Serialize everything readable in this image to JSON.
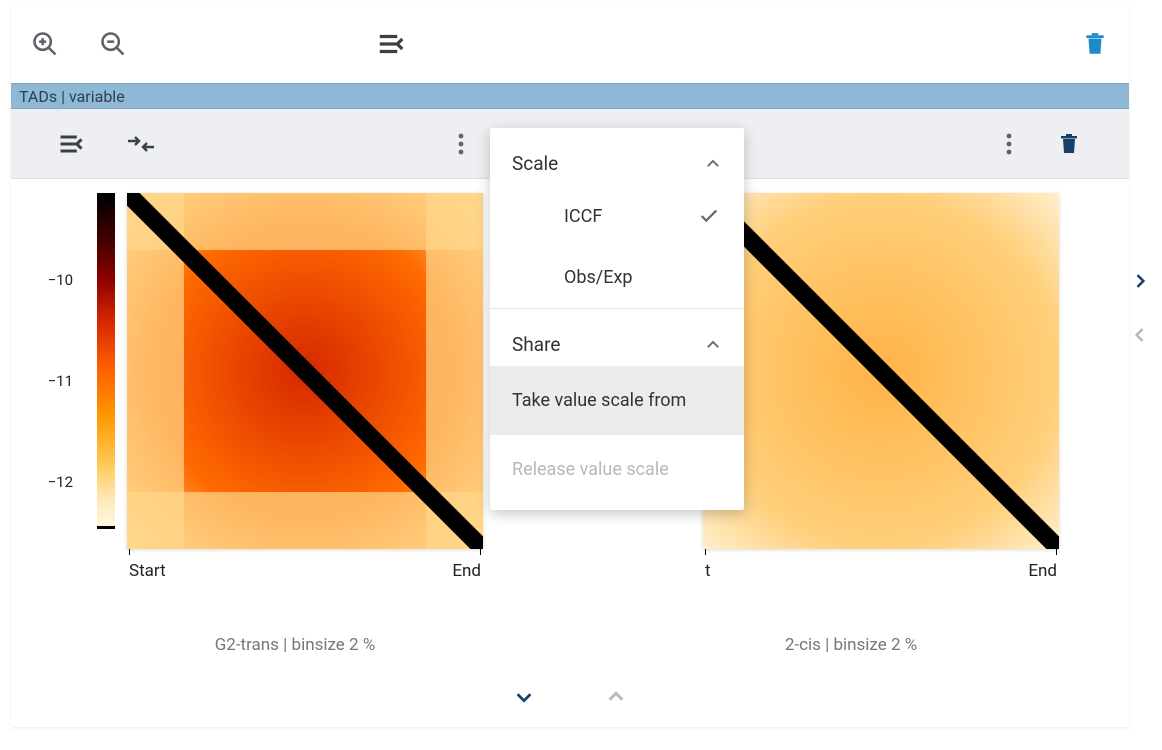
{
  "topbar": {
    "zoom_in_icon": "zoom-in",
    "zoom_out_icon": "zoom-out",
    "collapse_icon": "menu-collapse",
    "trash_icon": "trash"
  },
  "track_header": "TADs | variable",
  "panel_toolbar": {
    "collapse_icon": "menu-collapse",
    "merge_icon": "merge-arrows",
    "kebab_left": "more-vert",
    "kebab_right": "more-vert",
    "trash_right": "trash"
  },
  "colorbar": {
    "ticks": [
      "−10",
      "−11",
      "−12"
    ]
  },
  "panels": [
    {
      "caption": "G2-trans | binsize 2 %",
      "x_start": "Start",
      "x_end": "End"
    },
    {
      "caption": "2-cis | binsize 2 %",
      "x_start": "t",
      "x_end": "End"
    }
  ],
  "footer": {
    "down_icon": "chevron-down",
    "up_icon": "chevron-up"
  },
  "side": {
    "next_icon": "chevron-right",
    "prev_icon": "chevron-left"
  },
  "dropdown": {
    "scale_label": "Scale",
    "scale_options": [
      {
        "label": "ICCF",
        "selected": true
      },
      {
        "label": "Obs/Exp",
        "selected": false
      }
    ],
    "share_label": "Share",
    "take_from_label": "Take value scale from",
    "release_label": "Release value scale"
  }
}
